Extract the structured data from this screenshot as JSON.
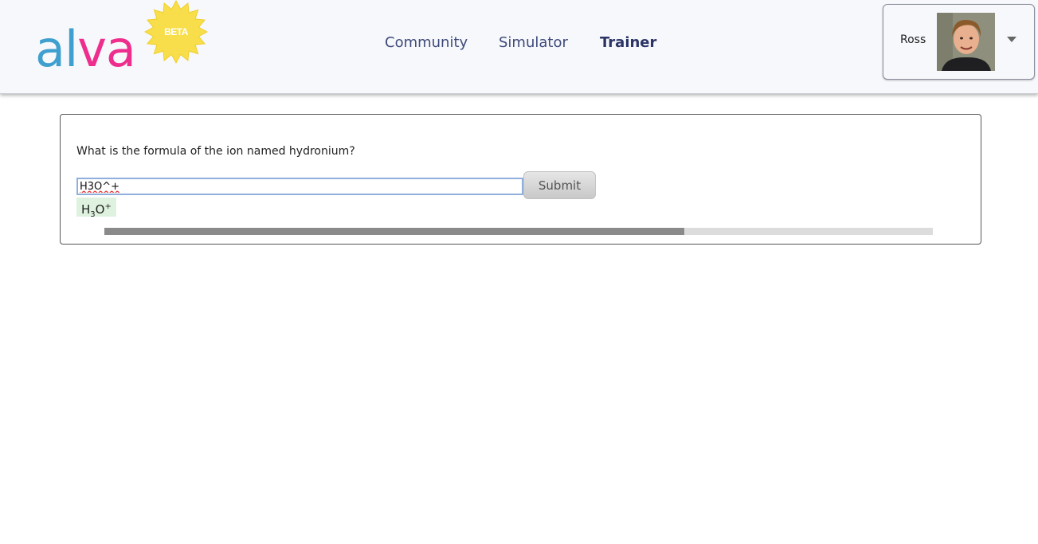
{
  "header": {
    "logo": {
      "text_part1": "al",
      "text_part2": "va",
      "badge": "BETA"
    },
    "nav": [
      {
        "label": "Community",
        "active": false
      },
      {
        "label": "Simulator",
        "active": false
      },
      {
        "label": "Trainer",
        "active": true
      }
    ],
    "user": {
      "name": "Ross",
      "menu_icon": "chevron-down-icon"
    }
  },
  "trainer": {
    "question": "What is the formula of the ion named hydronium?",
    "answer_value": "H3O^+",
    "submit_label": "Submit",
    "preview": {
      "base": "H",
      "sub": "3",
      "mid": "O",
      "sup": "+"
    },
    "progress_fraction": 0.7
  },
  "colors": {
    "logo_blue": "#3fa0cf",
    "logo_pink": "#ee2e8d",
    "beta_star": "#f7de4a",
    "nav_text": "#3e4a7a",
    "preview_bg": "#dff2df",
    "progress_fill": "#8a8a8a",
    "progress_track": "#dcdcdc"
  }
}
